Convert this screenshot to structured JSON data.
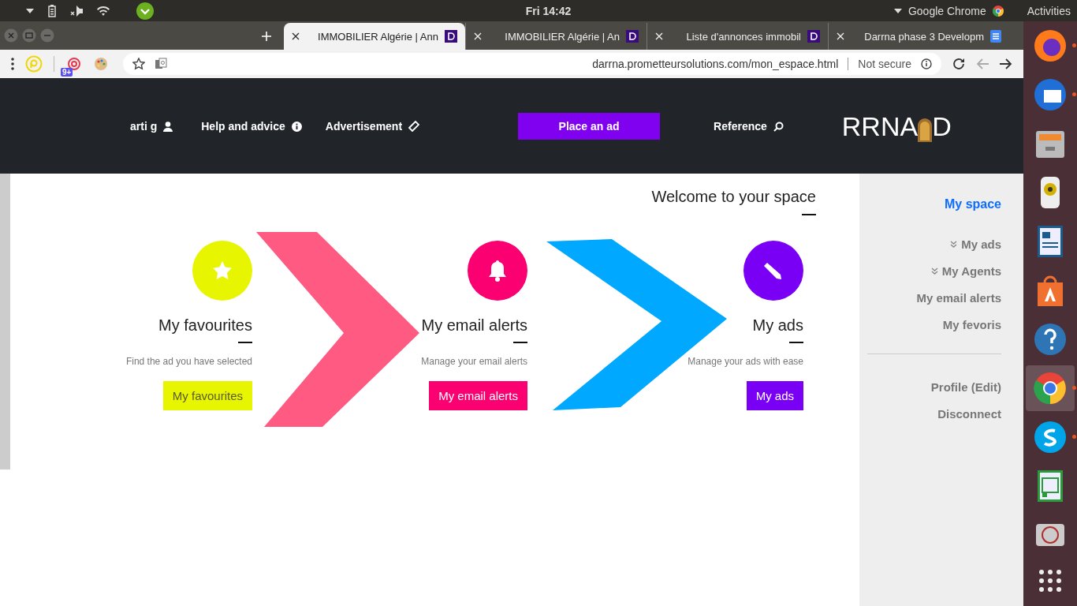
{
  "top_bar": {
    "activities": "Activities",
    "app_menu": "Google Chrome",
    "clock": "Fri 14:42"
  },
  "browser": {
    "tabs": [
      {
        "title": "IMMOBILIER Algérie | Ann",
        "kind": "site",
        "selected": true
      },
      {
        "title": "IMMOBILIER Algérie | An",
        "kind": "site",
        "selected": false
      },
      {
        "title": "Liste d'annonces immobil",
        "kind": "site",
        "selected": false
      },
      {
        "title": "Darrna phase 3 Developm",
        "kind": "doc",
        "selected": false
      }
    ],
    "extension_badge": "9+",
    "url": "darrna.prometteursolutions.com/mon_espace.html",
    "security": "Not secure"
  },
  "site": {
    "nav": [
      {
        "label": "arti g",
        "kind": "user"
      },
      {
        "label": "Help and advice",
        "kind": "info"
      },
      {
        "label": "Advertisement",
        "kind": "tag"
      },
      {
        "label": "Place an ad",
        "kind": "cta"
      },
      {
        "label": "Reference",
        "kind": "search"
      }
    ],
    "logo_start": "RRNA",
    "logo_end": "D"
  },
  "sidebar": {
    "title": "My space",
    "items": [
      {
        "label": "My ads",
        "expandable": true
      },
      {
        "label": "My Agents",
        "expandable": true
      },
      {
        "label": "My email alerts",
        "expandable": false
      },
      {
        "label": "My fevoris",
        "expandable": false
      }
    ],
    "account": [
      "Profile (Edit)",
      "Disconnect"
    ]
  },
  "page": {
    "title": "Welcome to your space",
    "cards": [
      {
        "title": "My favourites",
        "description": "Find the ad you have selected",
        "button": "My favourites",
        "color": "#e8f500"
      },
      {
        "title": "My email alerts",
        "description": "Manage your email alerts",
        "button": "My email alerts",
        "color": "#fa0070"
      },
      {
        "title": "My ads",
        "description": "Manage your ads with ease",
        "button": "My ads",
        "color": "#7a00f5"
      }
    ]
  },
  "dock": [
    {
      "running": true,
      "selected": false
    },
    {
      "running": true,
      "selected": false
    },
    {
      "running": false,
      "selected": false
    },
    {
      "running": false,
      "selected": false
    },
    {
      "running": false,
      "selected": false
    },
    {
      "running": false,
      "selected": false
    },
    {
      "running": false,
      "selected": false
    },
    {
      "running": true,
      "selected": true
    },
    {
      "running": true,
      "selected": false
    },
    {
      "running": false,
      "selected": false
    },
    {
      "running": false,
      "selected": false
    }
  ]
}
